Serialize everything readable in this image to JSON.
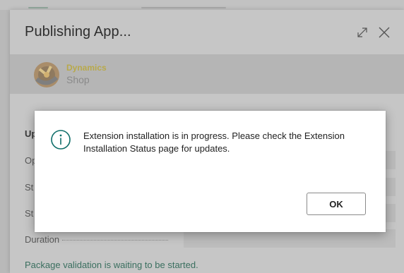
{
  "page": {
    "title": "Publishing App...",
    "logo": {
      "line1": "Dynamics",
      "line2": "Shop"
    },
    "section_label": "Up",
    "rows": [
      {
        "label": "Op"
      },
      {
        "label": "St"
      },
      {
        "label": "St"
      }
    ],
    "duration_label": "Duration",
    "status_text": "Package validation is waiting to be started."
  },
  "dialog": {
    "icon": "info-icon",
    "message": "Extension installation is in progress. Please check the Extension Installation Status page for updates.",
    "ok_label": "OK"
  },
  "icons": {
    "expand": "expand-icon",
    "close": "close-icon"
  },
  "colors": {
    "accent": "#0f6e6a",
    "logo_gold": "#b8a94a",
    "status_green": "#3a6f5f"
  }
}
